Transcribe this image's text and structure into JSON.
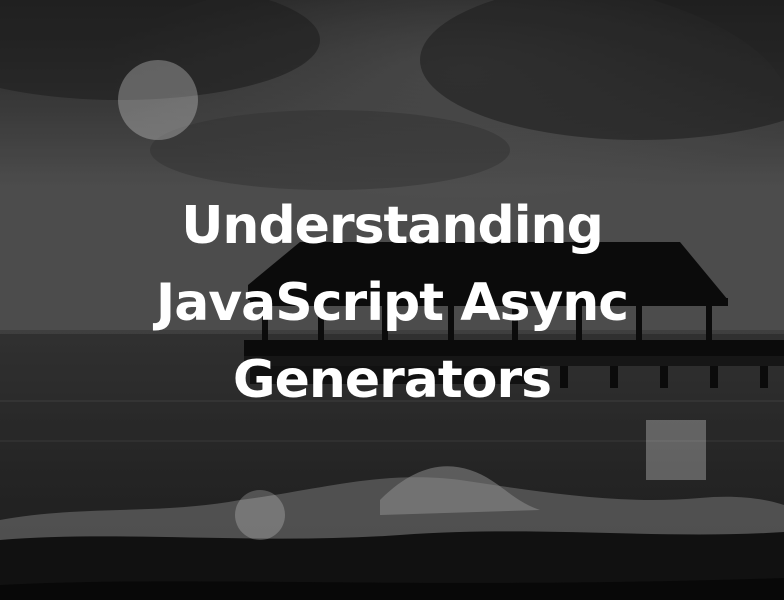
{
  "hero": {
    "title_lines": [
      "Understanding",
      "JavaScript Async",
      "Generators"
    ],
    "background_image": "grayscale-beach-pier-photo",
    "text_color": "#ffffff"
  },
  "decorations": {
    "large_circle": "translucent-circle-shape",
    "small_circle": "translucent-circle-shape",
    "square": "translucent-square-shape"
  }
}
